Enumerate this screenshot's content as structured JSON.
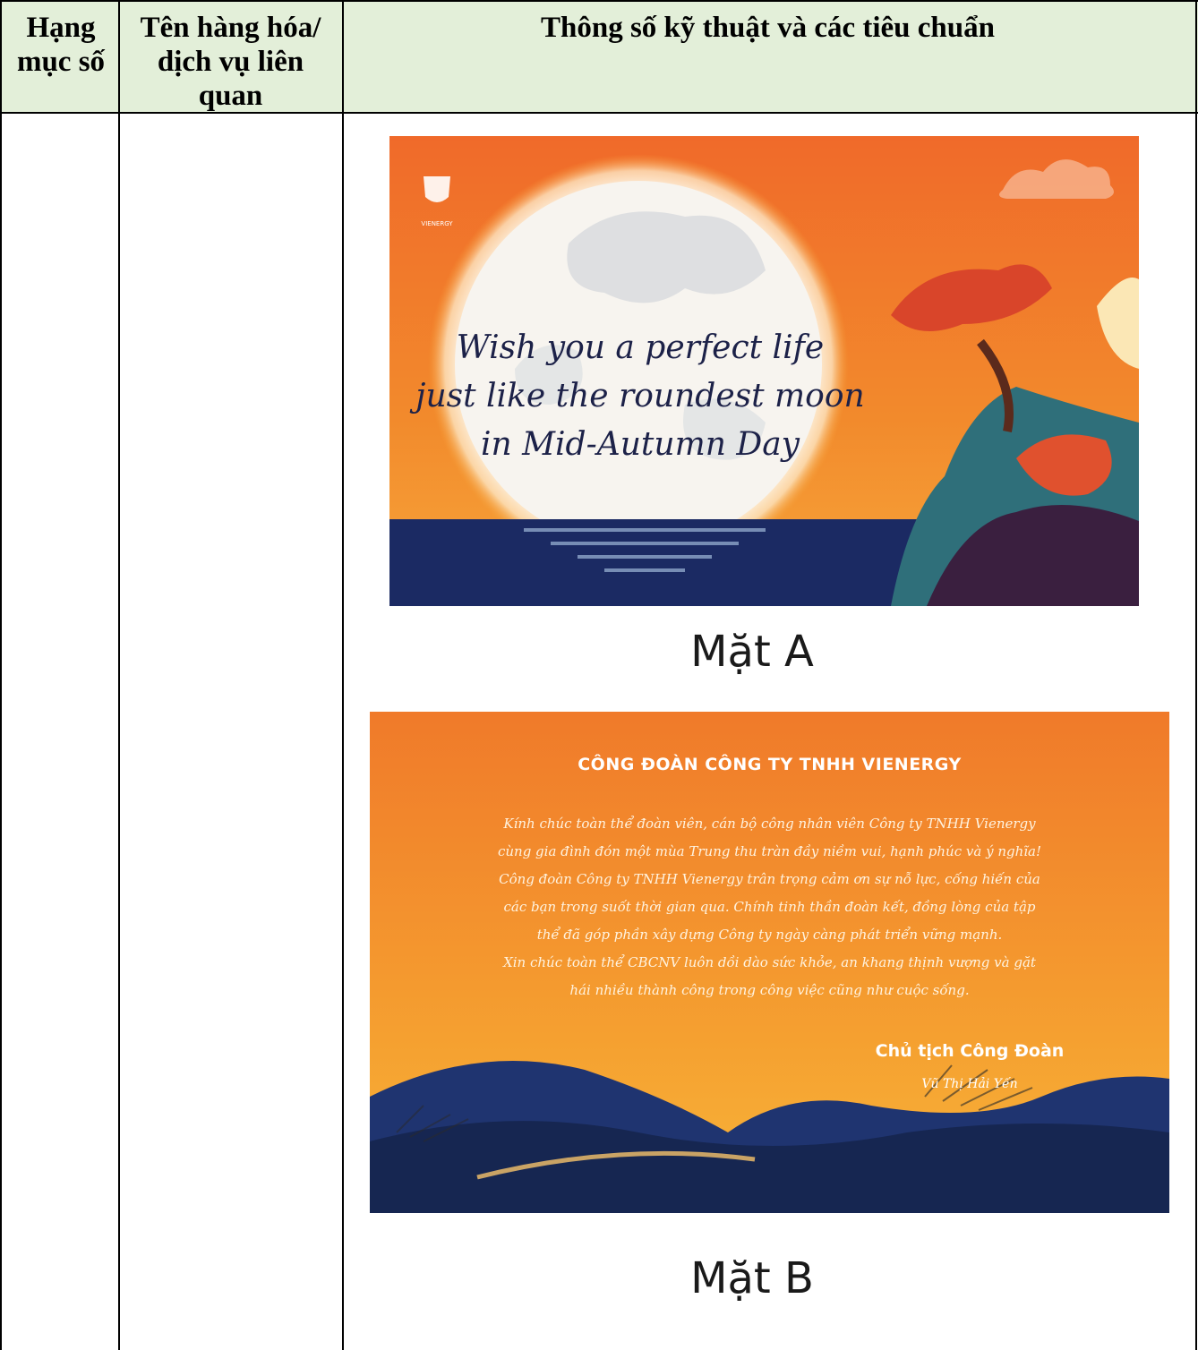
{
  "header": {
    "col1": "Hạng mục số",
    "col2": "Tên hàng hóa/ dịch vụ liên quan",
    "col3": "Thông số kỹ thuật và các tiêu chuẩn"
  },
  "card_a": {
    "logo_text": "VIENERGY",
    "message_line1": "Wish you a perfect life",
    "message_line2": "just like the roundest moon",
    "message_line3": "in Mid-Autumn Day",
    "caption": "Mặt A"
  },
  "card_b": {
    "title": "CÔNG ĐOÀN CÔNG TY TNHH VIENERGY",
    "body_line1": "Kính chúc toàn thể đoàn viên, cán bộ công nhân viên Công ty TNHH Vienergy",
    "body_line2": "cùng gia đình đón một mùa Trung thu tràn đầy niềm vui, hạnh phúc và ý nghĩa!",
    "body_line3": "Công đoàn Công ty TNHH Vienergy trân trọng cảm ơn sự nỗ lực, cống hiến của",
    "body_line4": "các bạn trong suốt thời gian qua. Chính tinh thần đoàn kết, đồng lòng của tập",
    "body_line5": "thể đã góp phần xây dựng Công ty ngày càng phát triển vững mạnh.",
    "body_line6": "Xin chúc toàn thể CBCNV luôn dồi dào sức khỏe, an khang thịnh vượng và gặt",
    "body_line7": "hái nhiều thành công trong công việc cũng như cuộc sống.",
    "signer_title": "Chủ tịch Công Đoàn",
    "signer_name": "Vũ Thị Hải Yến",
    "caption": "Mặt B"
  },
  "colors": {
    "header_bg": "#e3efd9",
    "card_orange": "#f07a2a",
    "card_navy": "#1b2a63"
  }
}
